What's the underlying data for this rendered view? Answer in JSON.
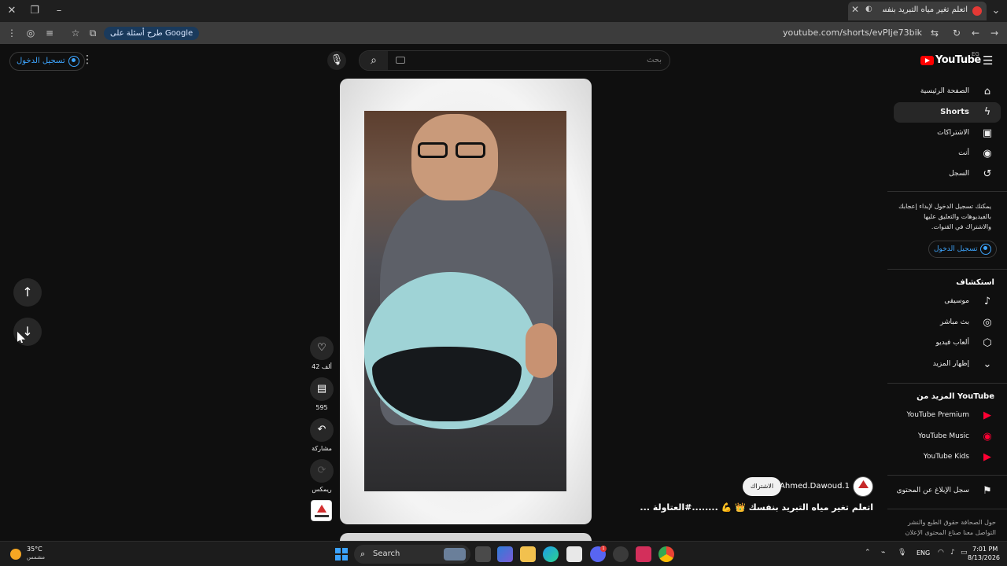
{
  "browser": {
    "tab_title": "اتعلم تغير مياه التبريد بنفسك",
    "ask_google_label": "طرح أسئلة على Google",
    "url": "youtube.com/shorts/evPIje73bik"
  },
  "header": {
    "sign_in_label": "تسجيل الدخول",
    "search_placeholder": "بحث",
    "logo_text": "YouTube",
    "country_code": "EG"
  },
  "guide": {
    "main_items": [
      {
        "label": "الصفحة الرئيسية",
        "icon": "home-icon"
      },
      {
        "label": "Shorts",
        "icon": "shorts-icon"
      },
      {
        "label": "الاشتراكات",
        "icon": "subscriptions-icon"
      },
      {
        "label": "أنت",
        "icon": "you-icon"
      },
      {
        "label": "السجل",
        "icon": "history-icon"
      }
    ],
    "signin_note": "يمكنك تسجيل الدخول لإبداء إعجابك بالفيديوهات والتعليق عليها والاشتراك في القنوات.",
    "signin_button": "تسجيل الدخول",
    "explore_title": "استكشاف",
    "explore_items": [
      {
        "label": "موسيقى",
        "icon": "music-icon"
      },
      {
        "label": "بث مباشر",
        "icon": "live-icon"
      },
      {
        "label": "ألعاب فيديو",
        "icon": "gaming-icon"
      },
      {
        "label": "إظهار المزيد",
        "icon": "chevron-down-icon"
      }
    ],
    "more_title": "المزيد من YouTube",
    "more_items": [
      {
        "label": "YouTube Premium"
      },
      {
        "label": "YouTube Music"
      },
      {
        "label": "YouTube Kids"
      }
    ],
    "report_label": "سجل الإبلاغ عن المحتوى",
    "footer": "حول الصحافة حقوق الطبع والنشر التواصل معنا صناع المحتوى الإعلان"
  },
  "short": {
    "likes": "42 ألف",
    "comments": "595",
    "share_label": "مشاركة",
    "remix_label": "ريمكس",
    "channel_name": "@Ahmed.Dawoud.1",
    "subscribe_label": "الاشتراك",
    "title": "اتعلم تغير مياه التبريد بنفسك 👑 💪 ........#العتاولة ..."
  },
  "taskbar": {
    "temperature": "35°C",
    "weather_desc": "مشمس",
    "search_label": "Search",
    "language": "ENG",
    "time": "7:01 PM",
    "date": "8/13/2026"
  },
  "colors": {
    "accent_blue": "#3ea6ff",
    "youtube_red": "#ff0000"
  }
}
